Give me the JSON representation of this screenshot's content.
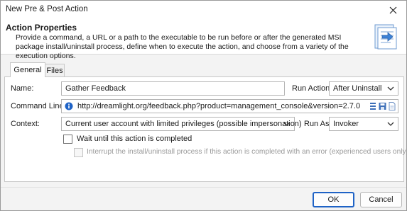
{
  "window": {
    "title": "New Pre & Post Action"
  },
  "header": {
    "title": "Action Properties",
    "description": "Provide a command, a URL or a path to the executable to be run before or after the generated MSI package install/uninstall process, define when to execute the action, and choose from a variety of the execution options.",
    "icon": "action-document-icon"
  },
  "tabs": [
    {
      "label": "General",
      "active": true
    },
    {
      "label": "Files",
      "active": false
    }
  ],
  "form": {
    "name_label": "Name:",
    "name_value": "Gather Feedback",
    "run_action_label": "Run Action:",
    "run_action_value": "After Uninstall",
    "command_label": "Command Line:",
    "command_value": "http://dreamlight.org/feedback.php?product=management_console&version=2.7.0",
    "context_label": "Context:",
    "context_value": "Current user account with limited privileges (possible impersonation)",
    "run_as_label": "Run As:",
    "run_as_value": "Invoker",
    "wait_label": "Wait until this action is completed",
    "interrupt_label": "Interrupt the install/uninstall process if this action is completed with an error (experienced users only)"
  },
  "buttons": {
    "ok": "OK",
    "cancel": "Cancel"
  },
  "colors": {
    "accent": "#1f63c6",
    "info": "#1f63c6"
  }
}
